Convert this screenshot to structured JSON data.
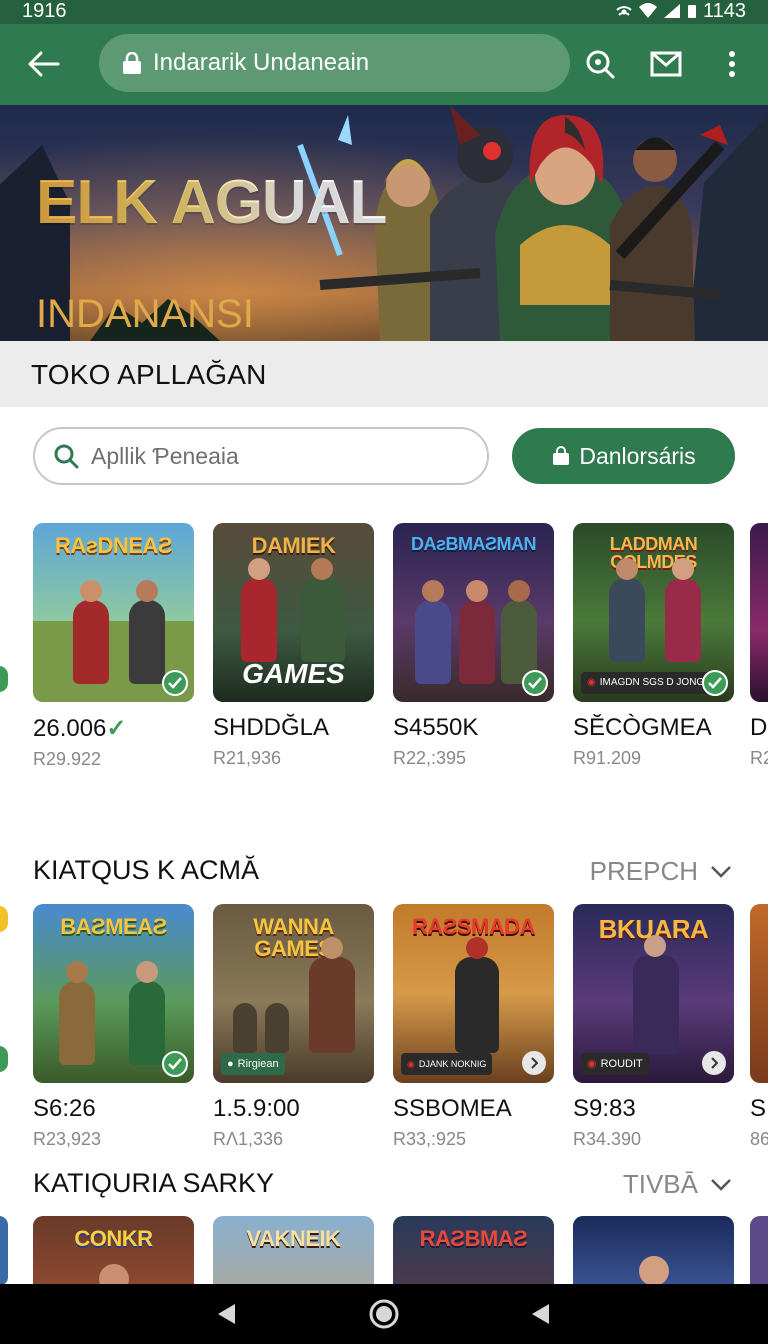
{
  "status_bar": {
    "time": "1916",
    "clock": "1143"
  },
  "app_bar": {
    "url_text": "Indararik Undaneain",
    "icons": [
      "back-arrow-icon",
      "lock-icon",
      "search-refresh-icon",
      "mail-icon",
      "more-vert-icon"
    ]
  },
  "hero": {
    "title": "ELK AGUAL",
    "subtitle": "INDANANSI"
  },
  "store": {
    "title": "TOKO APLLAĞAN"
  },
  "search": {
    "placeholder": "Apllik Ƥeneaia",
    "download_label": "Danlorsáris"
  },
  "row1": {
    "items": [
      {
        "name": "26.006",
        "price": "R29.922",
        "logo": "RAƨDNEAƧ",
        "badge": "check"
      },
      {
        "name": "SHDDĞLA",
        "price": "R21,936",
        "logo": "DAMIEK",
        "tag": "GAMES"
      },
      {
        "name": "S4550K",
        "price": "R22,:395",
        "logo": "DAƨBMAƧMAN",
        "badge": "check"
      },
      {
        "name": "SĔCÒGMEA",
        "price": "R91.209",
        "logo": "LADDMAN COLMDES",
        "pill": "IMAGDN SGS D JONG",
        "badge": "check"
      },
      {
        "name": "D",
        "price": "R2"
      }
    ]
  },
  "section2": {
    "title": "KIATQUS K ACMĂ",
    "more_label": "PREPCH",
    "items": [
      {
        "name": "S6:26",
        "price": "R23,923",
        "logo": "BAƧMEAƧ",
        "badge": "check"
      },
      {
        "name": "1.5.9:00",
        "price": "RΛ1,336",
        "logo": "WANNA GAMES",
        "pill": "Rirgiean"
      },
      {
        "name": "SSBOMEA",
        "price": "R33,:925",
        "logo": "RAƧSMADA",
        "pill": "DJANK NOKNIG",
        "badge": "next"
      },
      {
        "name": "S9:83",
        "price": "R34.390",
        "logo": "BKUARA",
        "pill": "ROUDIT",
        "badge": "next"
      },
      {
        "name": "S",
        "price": "86"
      }
    ]
  },
  "section3": {
    "title": "KATIǪURIA SARKY",
    "more_label": "TIVBĀ",
    "items": [
      {
        "logo": "CONKR"
      },
      {
        "logo": "VAKNEIK"
      },
      {
        "logo": "RAƧBMAƧ"
      },
      {
        "logo": ""
      }
    ]
  },
  "nav": {
    "icons": [
      "back-triangle-icon",
      "home-circle-icon",
      "recents-triangle-icon"
    ]
  },
  "colors": {
    "primary": "#2f7a4f",
    "status_bar": "#25603f",
    "check_badge": "#3d9a57"
  }
}
